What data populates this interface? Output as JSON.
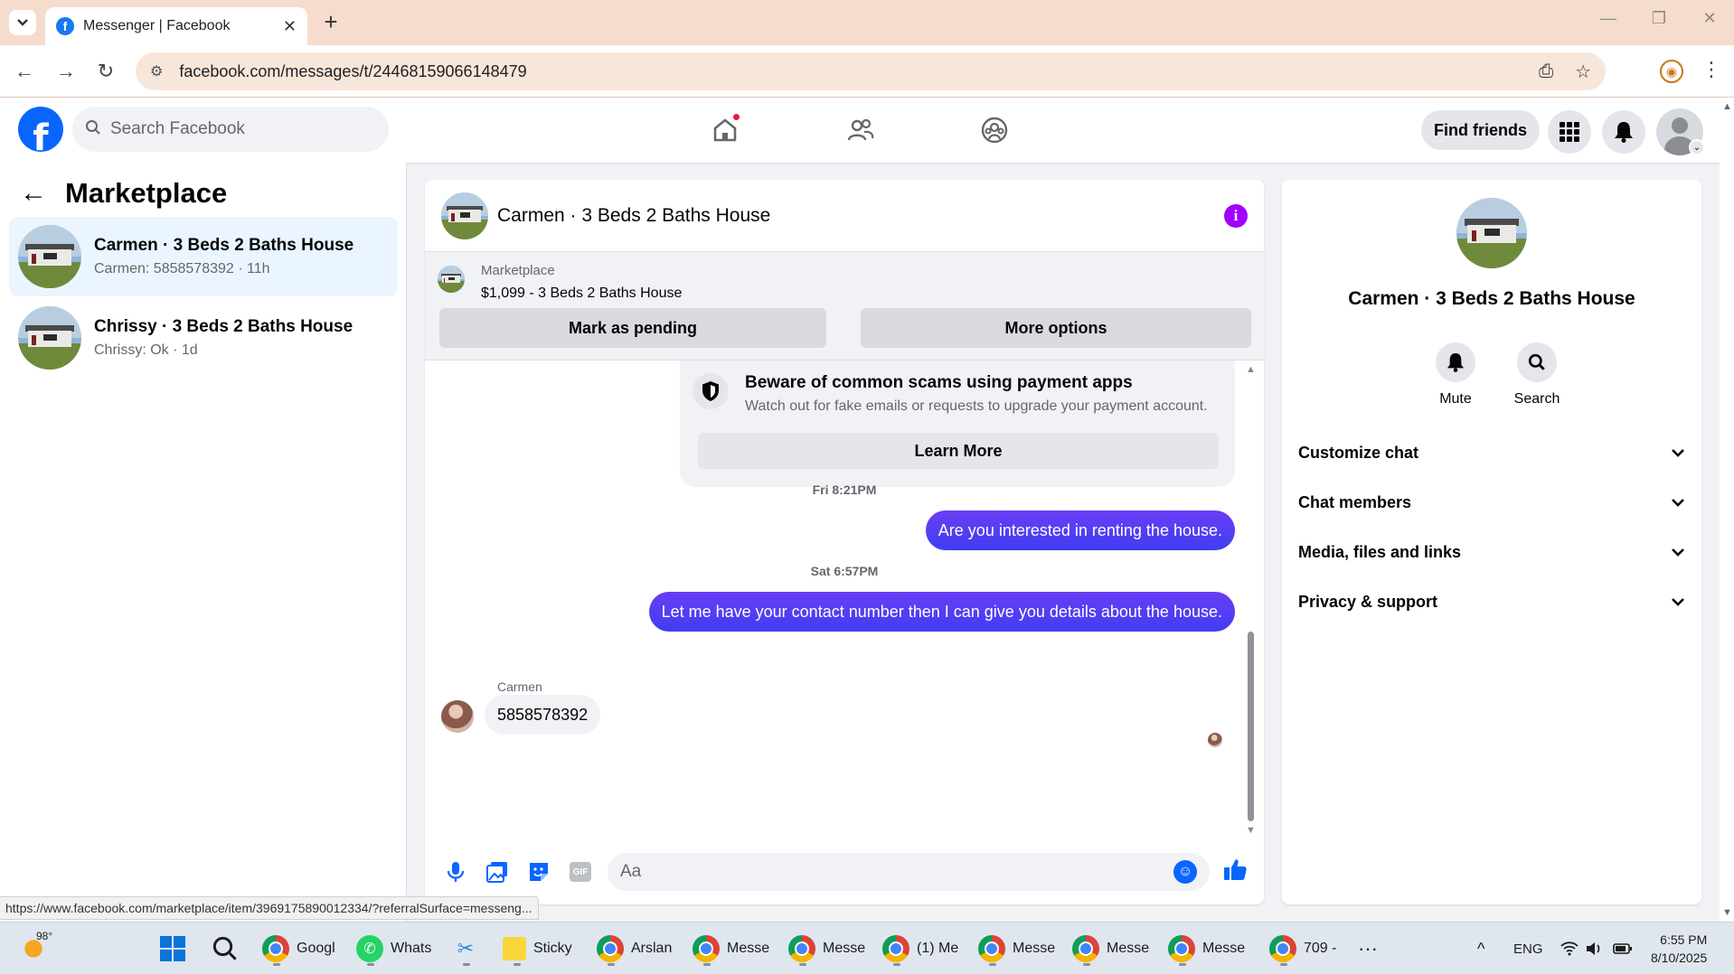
{
  "browser": {
    "tab_title": "Messenger | Facebook",
    "url": "facebook.com/messages/t/24468159066148479",
    "status_url": "https://www.facebook.com/marketplace/item/3969175890012334/?referralSurface=messeng..."
  },
  "header": {
    "search_placeholder": "Search Facebook",
    "find_friends": "Find friends"
  },
  "sidebar": {
    "title": "Marketplace",
    "conversations": [
      {
        "name": "Carmen · 3 Beds 2 Baths House",
        "preview": "Carmen: 5858578392 · 11h",
        "active": true
      },
      {
        "name": "Chrissy · 3 Beds 2 Baths House",
        "preview": "Chrissy: Ok · 1d",
        "active": false
      }
    ]
  },
  "chat": {
    "title": "Carmen · 3 Beds 2 Baths House",
    "listing": {
      "source": "Marketplace",
      "price_title": "$1,099 - 3 Beds 2 Baths House",
      "mark_pending": "Mark as pending",
      "more_options": "More options"
    },
    "scam_notice": {
      "title": "Beware of common scams using payment apps",
      "subtitle": "Watch out for fake emails or requests to upgrade your payment account.",
      "button": "Learn More"
    },
    "messages": [
      {
        "timestamp": "Fri 8:21PM",
        "text": "Are you interested in renting the house."
      },
      {
        "timestamp": "Sat 6:57PM",
        "text": "Let me have your contact number then I can give you details about the house."
      }
    ],
    "incoming": {
      "sender": "Carmen",
      "text": "5858578392"
    },
    "composer_placeholder": "Aa",
    "gif_label": "GIF"
  },
  "info_panel": {
    "name": "Carmen · 3 Beds 2 Baths House",
    "actions": [
      {
        "label": "Mute"
      },
      {
        "label": "Search"
      }
    ],
    "sections": [
      "Customize chat",
      "Chat members",
      "Media, files and links",
      "Privacy & support"
    ]
  },
  "taskbar": {
    "weather": "98°",
    "apps": [
      "Googl",
      "Whats",
      "Sticky",
      "Arslan",
      "Messe",
      "Messe",
      "(1) Me",
      "Messe",
      "Messe",
      "Messe",
      "709 -"
    ],
    "language": "ENG",
    "time": "6:55 PM",
    "date": "8/10/2025"
  },
  "colors": {
    "fb_blue": "#0866ff",
    "bubble_purple": "#5b34ff",
    "info_purple": "#a200ff"
  }
}
